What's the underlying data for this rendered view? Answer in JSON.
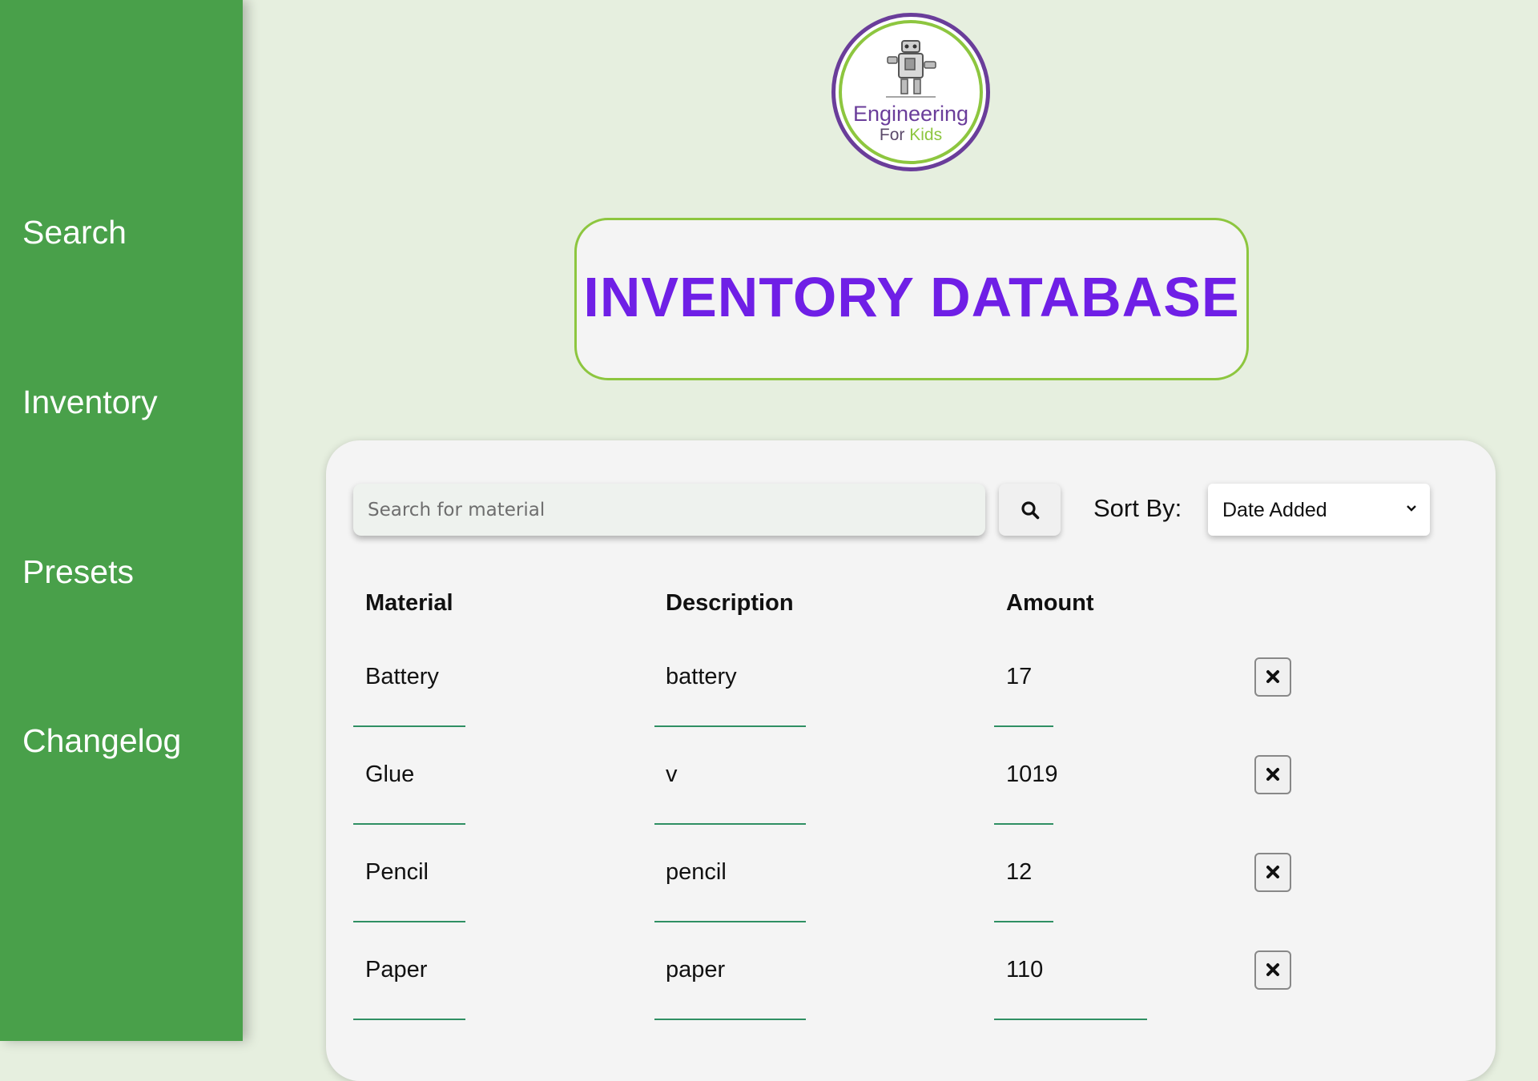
{
  "sidebar": {
    "items": [
      {
        "label": "Search"
      },
      {
        "label": "Inventory"
      },
      {
        "label": "Presets"
      },
      {
        "label": "Changelog"
      }
    ]
  },
  "logo": {
    "line1": "Engineering",
    "line2_a": "For",
    "line2_b": "Kids"
  },
  "header": {
    "title": "INVENTORY DATABASE"
  },
  "toolbar": {
    "search_placeholder": "Search for material",
    "search_icon": "magnifier-icon",
    "sort_label": "Sort By:",
    "sort_selected": "Date Added"
  },
  "table": {
    "columns": [
      "Material",
      "Description",
      "Amount"
    ],
    "rows": [
      {
        "material": "Battery",
        "description": "battery",
        "amount": "17"
      },
      {
        "material": "Glue",
        "description": "v",
        "amount": "1019"
      },
      {
        "material": "Pencil",
        "description": "pencil",
        "amount": "12"
      },
      {
        "material": "Paper",
        "description": "paper",
        "amount": "110"
      }
    ],
    "delete_icon": "x-icon"
  },
  "colors": {
    "sidebar": "#49a04a",
    "background": "#e6efdf",
    "title": "#6f1fe6",
    "accent_green": "#8dc63f",
    "logo_purple": "#6a3d9a",
    "underline": "#2f8f63"
  }
}
